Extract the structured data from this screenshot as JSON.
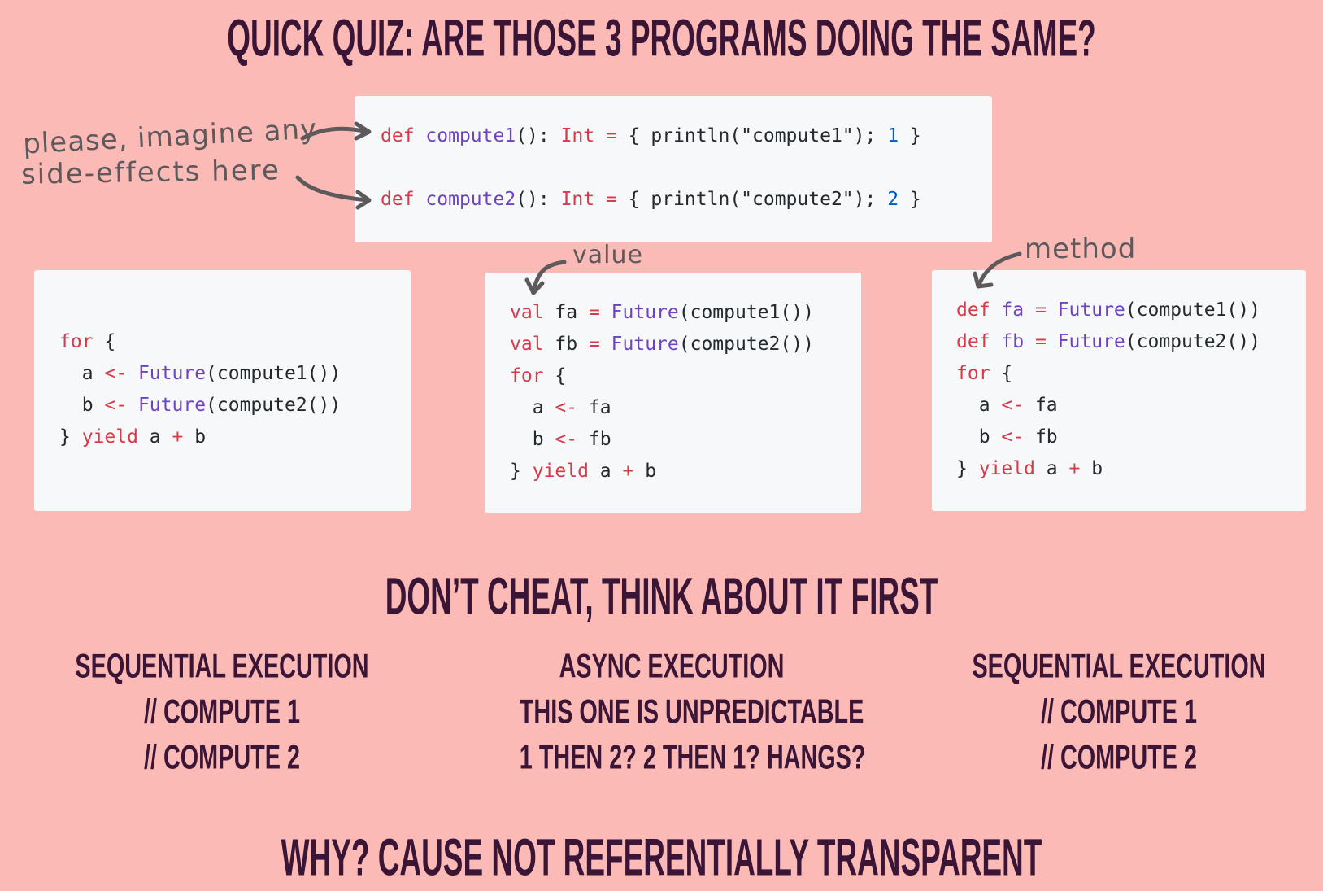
{
  "title": "QUICK QUIZ: ARE THOSE 3 PROGRAMS DOING THE SAME?",
  "annotations": {
    "side_effects_line1": "please, imagine any",
    "side_effects_line2": "side-effects here",
    "value": "value",
    "method": "method"
  },
  "definitions": [
    [
      {
        "t": "def",
        "c": "kw"
      },
      {
        "t": " ",
        "c": "pl"
      },
      {
        "t": "compute1",
        "c": "fn"
      },
      {
        "t": "(): ",
        "c": "pl"
      },
      {
        "t": "Int",
        "c": "kw"
      },
      {
        "t": " ",
        "c": "pl"
      },
      {
        "t": "=",
        "c": "kw"
      },
      {
        "t": " { println(\"compute1\"); ",
        "c": "pl"
      },
      {
        "t": "1",
        "c": "num"
      },
      {
        "t": " }",
        "c": "pl"
      }
    ],
    [],
    [
      {
        "t": "def",
        "c": "kw"
      },
      {
        "t": " ",
        "c": "pl"
      },
      {
        "t": "compute2",
        "c": "fn"
      },
      {
        "t": "(): ",
        "c": "pl"
      },
      {
        "t": "Int",
        "c": "kw"
      },
      {
        "t": " ",
        "c": "pl"
      },
      {
        "t": "=",
        "c": "kw"
      },
      {
        "t": " { println(\"compute2\"); ",
        "c": "pl"
      },
      {
        "t": "2",
        "c": "num"
      },
      {
        "t": " }",
        "c": "pl"
      }
    ]
  ],
  "programs": [
    [
      [
        {
          "t": "for",
          "c": "kw"
        },
        {
          "t": " {",
          "c": "pl"
        }
      ],
      [
        {
          "t": "  a ",
          "c": "pl"
        },
        {
          "t": "<-",
          "c": "kw"
        },
        {
          "t": " ",
          "c": "pl"
        },
        {
          "t": "Future",
          "c": "fn"
        },
        {
          "t": "(compute1())",
          "c": "pl"
        }
      ],
      [
        {
          "t": "  b ",
          "c": "pl"
        },
        {
          "t": "<-",
          "c": "kw"
        },
        {
          "t": " ",
          "c": "pl"
        },
        {
          "t": "Future",
          "c": "fn"
        },
        {
          "t": "(compute2())",
          "c": "pl"
        }
      ],
      [
        {
          "t": "} ",
          "c": "pl"
        },
        {
          "t": "yield",
          "c": "kw"
        },
        {
          "t": " a ",
          "c": "pl"
        },
        {
          "t": "+",
          "c": "kw"
        },
        {
          "t": " b",
          "c": "pl"
        }
      ]
    ],
    [
      [
        {
          "t": "val",
          "c": "kw"
        },
        {
          "t": " fa ",
          "c": "pl"
        },
        {
          "t": "=",
          "c": "kw"
        },
        {
          "t": " ",
          "c": "pl"
        },
        {
          "t": "Future",
          "c": "fn"
        },
        {
          "t": "(compute1())",
          "c": "pl"
        }
      ],
      [
        {
          "t": "val",
          "c": "kw"
        },
        {
          "t": " fb ",
          "c": "pl"
        },
        {
          "t": "=",
          "c": "kw"
        },
        {
          "t": " ",
          "c": "pl"
        },
        {
          "t": "Future",
          "c": "fn"
        },
        {
          "t": "(compute2())",
          "c": "pl"
        }
      ],
      [
        {
          "t": "for",
          "c": "kw"
        },
        {
          "t": " {",
          "c": "pl"
        }
      ],
      [
        {
          "t": "  a ",
          "c": "pl"
        },
        {
          "t": "<-",
          "c": "kw"
        },
        {
          "t": " fa",
          "c": "pl"
        }
      ],
      [
        {
          "t": "  b ",
          "c": "pl"
        },
        {
          "t": "<-",
          "c": "kw"
        },
        {
          "t": " fb",
          "c": "pl"
        }
      ],
      [
        {
          "t": "} ",
          "c": "pl"
        },
        {
          "t": "yield",
          "c": "kw"
        },
        {
          "t": " a ",
          "c": "pl"
        },
        {
          "t": "+",
          "c": "kw"
        },
        {
          "t": " b",
          "c": "pl"
        }
      ]
    ],
    [
      [
        {
          "t": "def",
          "c": "kw"
        },
        {
          "t": " ",
          "c": "pl"
        },
        {
          "t": "fa",
          "c": "fn"
        },
        {
          "t": " ",
          "c": "pl"
        },
        {
          "t": "=",
          "c": "kw"
        },
        {
          "t": " ",
          "c": "pl"
        },
        {
          "t": "Future",
          "c": "fn"
        },
        {
          "t": "(compute1())",
          "c": "pl"
        }
      ],
      [
        {
          "t": "def",
          "c": "kw"
        },
        {
          "t": " ",
          "c": "pl"
        },
        {
          "t": "fb",
          "c": "fn"
        },
        {
          "t": " ",
          "c": "pl"
        },
        {
          "t": "=",
          "c": "kw"
        },
        {
          "t": " ",
          "c": "pl"
        },
        {
          "t": "Future",
          "c": "fn"
        },
        {
          "t": "(compute2())",
          "c": "pl"
        }
      ],
      [
        {
          "t": "for",
          "c": "kw"
        },
        {
          "t": " {",
          "c": "pl"
        }
      ],
      [
        {
          "t": "  a ",
          "c": "pl"
        },
        {
          "t": "<-",
          "c": "kw"
        },
        {
          "t": " fa",
          "c": "pl"
        }
      ],
      [
        {
          "t": "  b ",
          "c": "pl"
        },
        {
          "t": "<-",
          "c": "kw"
        },
        {
          "t": " fb",
          "c": "pl"
        }
      ],
      [
        {
          "t": "} ",
          "c": "pl"
        },
        {
          "t": "yield",
          "c": "kw"
        },
        {
          "t": " a ",
          "c": "pl"
        },
        {
          "t": "+",
          "c": "kw"
        },
        {
          "t": " b",
          "c": "pl"
        }
      ]
    ]
  ],
  "prompt": "DON’T CHEAT, THINK ABOUT IT FIRST",
  "answers": [
    {
      "line1": "SEQUENTIAL EXECUTION",
      "line2": "// COMPUTE 1",
      "line3": "// COMPUTE 2"
    },
    {
      "line1": "ASYNC EXECUTION",
      "line2": "THIS ONE IS UNPREDICTABLE",
      "line3": "1 THEN 2? 2 THEN 1? HANGS?"
    },
    {
      "line1": "SEQUENTIAL EXECUTION",
      "line2": "// COMPUTE 1",
      "line3": "// COMPUTE 2"
    }
  ],
  "conclusion": "WHY? CAUSE NOT REFERENTIALLY TRANSPARENT",
  "colors": {
    "background": "#fcbab6",
    "heading": "#3a1536",
    "code_background": "#f6f8fa",
    "keyword": "#d73a49",
    "function": "#6f42c1",
    "number": "#005cc5",
    "annotation": "#5e5a5c"
  }
}
